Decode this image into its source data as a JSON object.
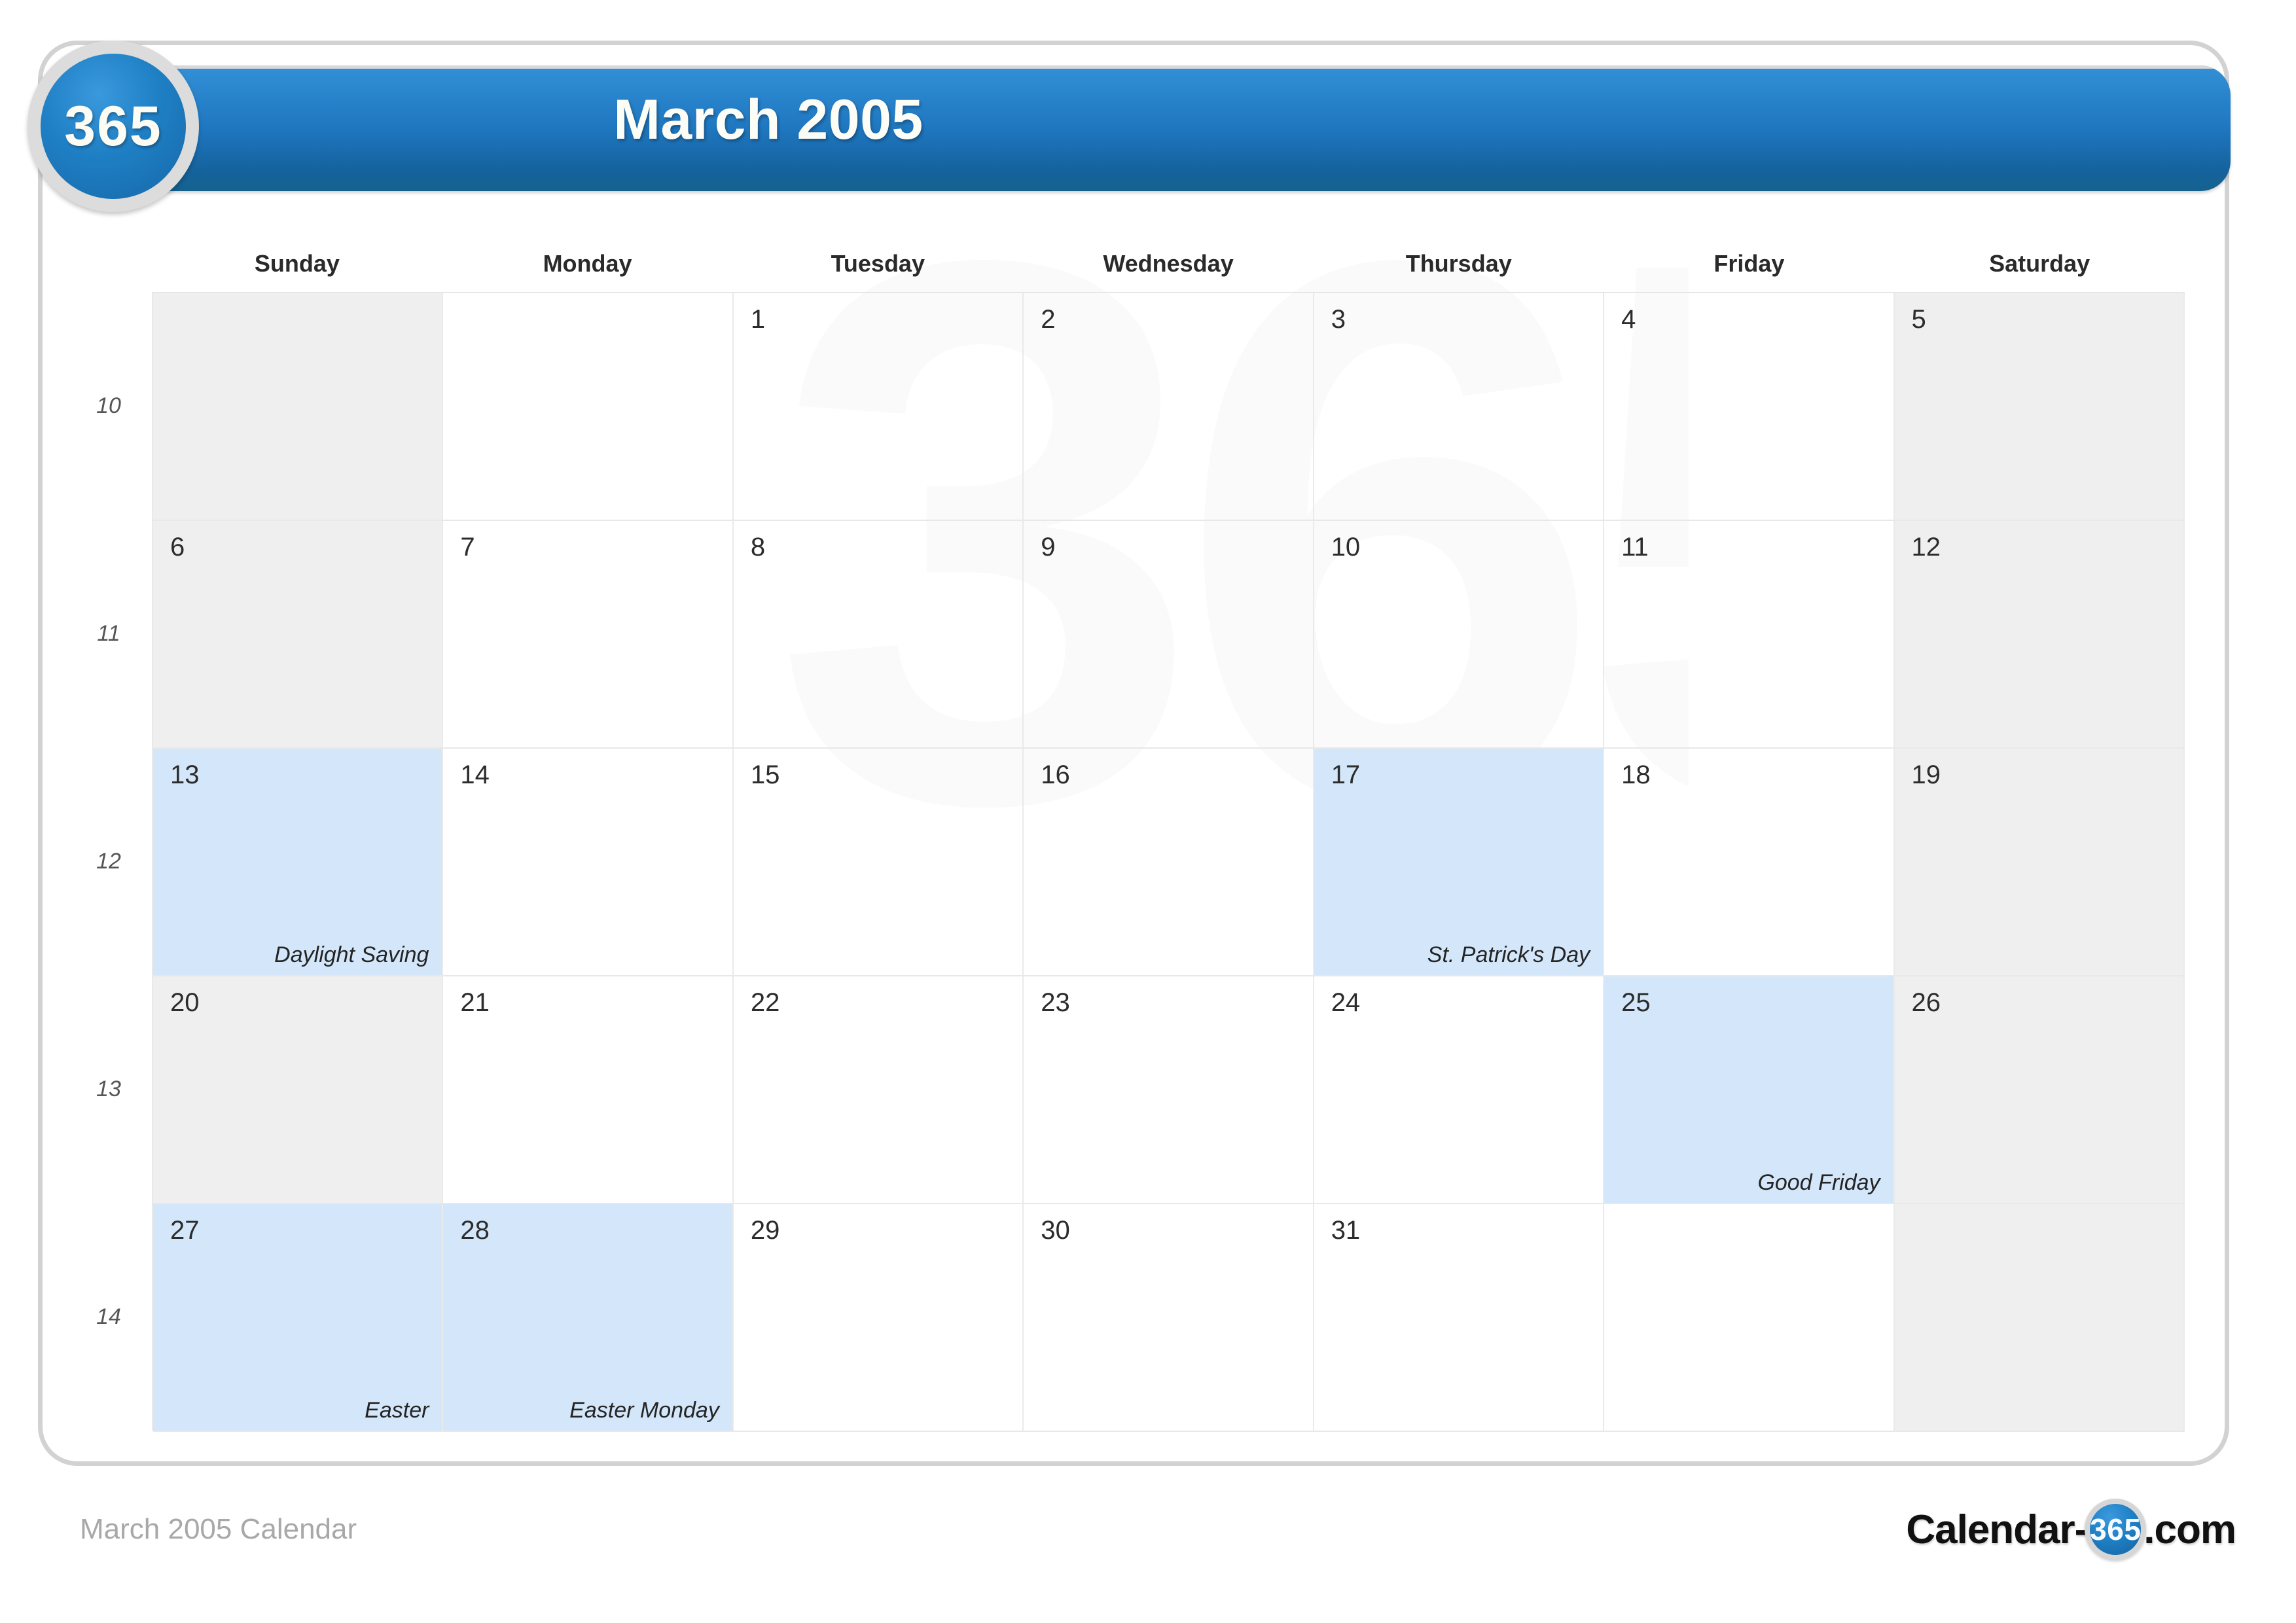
{
  "header": {
    "title": "March 2005",
    "badge_label": "365"
  },
  "weekdays": [
    "Sunday",
    "Monday",
    "Tuesday",
    "Wednesday",
    "Thursday",
    "Friday",
    "Saturday"
  ],
  "week_numbers": [
    "10",
    "11",
    "12",
    "13",
    "14"
  ],
  "weeks": [
    {
      "week_number": "10",
      "days": [
        {
          "num": "",
          "event": "",
          "weekend": true,
          "highlight": false,
          "empty": true
        },
        {
          "num": "",
          "event": "",
          "weekend": false,
          "highlight": false,
          "empty": true
        },
        {
          "num": "1",
          "event": "",
          "weekend": false,
          "highlight": false,
          "empty": false
        },
        {
          "num": "2",
          "event": "",
          "weekend": false,
          "highlight": false,
          "empty": false
        },
        {
          "num": "3",
          "event": "",
          "weekend": false,
          "highlight": false,
          "empty": false
        },
        {
          "num": "4",
          "event": "",
          "weekend": false,
          "highlight": false,
          "empty": false
        },
        {
          "num": "5",
          "event": "",
          "weekend": true,
          "highlight": false,
          "empty": false
        }
      ]
    },
    {
      "week_number": "11",
      "days": [
        {
          "num": "6",
          "event": "",
          "weekend": true,
          "highlight": false,
          "empty": false
        },
        {
          "num": "7",
          "event": "",
          "weekend": false,
          "highlight": false,
          "empty": false
        },
        {
          "num": "8",
          "event": "",
          "weekend": false,
          "highlight": false,
          "empty": false
        },
        {
          "num": "9",
          "event": "",
          "weekend": false,
          "highlight": false,
          "empty": false
        },
        {
          "num": "10",
          "event": "",
          "weekend": false,
          "highlight": false,
          "empty": false
        },
        {
          "num": "11",
          "event": "",
          "weekend": false,
          "highlight": false,
          "empty": false
        },
        {
          "num": "12",
          "event": "",
          "weekend": true,
          "highlight": false,
          "empty": false
        }
      ]
    },
    {
      "week_number": "12",
      "days": [
        {
          "num": "13",
          "event": "Daylight Saving",
          "weekend": true,
          "highlight": true,
          "empty": false
        },
        {
          "num": "14",
          "event": "",
          "weekend": false,
          "highlight": false,
          "empty": false
        },
        {
          "num": "15",
          "event": "",
          "weekend": false,
          "highlight": false,
          "empty": false
        },
        {
          "num": "16",
          "event": "",
          "weekend": false,
          "highlight": false,
          "empty": false
        },
        {
          "num": "17",
          "event": "St. Patrick's Day",
          "weekend": false,
          "highlight": true,
          "empty": false
        },
        {
          "num": "18",
          "event": "",
          "weekend": false,
          "highlight": false,
          "empty": false
        },
        {
          "num": "19",
          "event": "",
          "weekend": true,
          "highlight": false,
          "empty": false
        }
      ]
    },
    {
      "week_number": "13",
      "days": [
        {
          "num": "20",
          "event": "",
          "weekend": true,
          "highlight": false,
          "empty": false
        },
        {
          "num": "21",
          "event": "",
          "weekend": false,
          "highlight": false,
          "empty": false
        },
        {
          "num": "22",
          "event": "",
          "weekend": false,
          "highlight": false,
          "empty": false
        },
        {
          "num": "23",
          "event": "",
          "weekend": false,
          "highlight": false,
          "empty": false
        },
        {
          "num": "24",
          "event": "",
          "weekend": false,
          "highlight": false,
          "empty": false
        },
        {
          "num": "25",
          "event": "Good Friday",
          "weekend": false,
          "highlight": true,
          "empty": false
        },
        {
          "num": "26",
          "event": "",
          "weekend": true,
          "highlight": false,
          "empty": false
        }
      ]
    },
    {
      "week_number": "14",
      "days": [
        {
          "num": "27",
          "event": "Easter",
          "weekend": true,
          "highlight": true,
          "empty": false
        },
        {
          "num": "28",
          "event": "Easter Monday",
          "weekend": false,
          "highlight": true,
          "empty": false
        },
        {
          "num": "29",
          "event": "",
          "weekend": false,
          "highlight": false,
          "empty": false
        },
        {
          "num": "30",
          "event": "",
          "weekend": false,
          "highlight": false,
          "empty": false
        },
        {
          "num": "31",
          "event": "",
          "weekend": false,
          "highlight": false,
          "empty": false
        },
        {
          "num": "",
          "event": "",
          "weekend": false,
          "highlight": false,
          "empty": true
        },
        {
          "num": "",
          "event": "",
          "weekend": true,
          "highlight": false,
          "empty": true
        }
      ]
    }
  ],
  "watermark": {
    "text": "365"
  },
  "footer": {
    "caption": "March 2005 Calendar",
    "logo_prefix": "Calendar-",
    "logo_badge": "365",
    "logo_suffix": ".com"
  },
  "colors": {
    "header_blue": "#1f77c0",
    "highlight_blue": "#d4e7fa",
    "weekend_gray": "#efefef",
    "frame_gray": "#d2d2d2"
  }
}
